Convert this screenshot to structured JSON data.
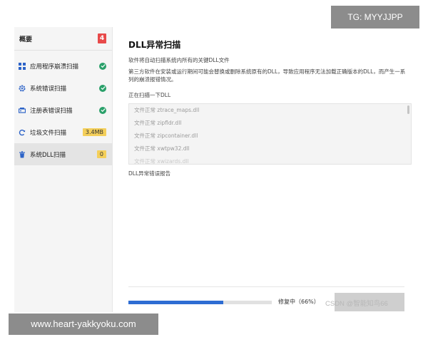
{
  "sidebar": {
    "header": {
      "title": "概要",
      "count": "4"
    },
    "items": [
      {
        "label": "应用程序崩溃扫描",
        "icon": "app-grid-icon",
        "status": "done"
      },
      {
        "label": "系统错误扫描",
        "icon": "gear-icon",
        "status": "done"
      },
      {
        "label": "注册表错误扫描",
        "icon": "registry-icon",
        "status": "done"
      },
      {
        "label": "垃圾文件扫描",
        "icon": "refresh-icon",
        "badge": "3.4MB"
      },
      {
        "label": "系统DLL扫描",
        "icon": "trash-icon",
        "badge": "0"
      }
    ]
  },
  "main": {
    "title": "DLL异常扫描",
    "desc1": "软件将自动扫描系统内所有的关键DLL文件",
    "desc2": "第三方软件在安装或运行期间可能会替换或删除系统原有的DLL，导致应用程序无法加载正确版本的DLL，而产生一系列的崩溃报错情况。",
    "scanning_label": "正在扫描一下DLL",
    "scan_list": [
      "文件正常 ztrace_maps.dll",
      "文件正常 zipfldr.dll",
      "文件正常 zipcontainer.dll",
      "文件正常 xwtpw32.dll",
      "文件正常 xwizards.dll"
    ],
    "report_label": "DLL异常错误报告",
    "progress": {
      "percent": 66,
      "text": "修复中（66%）"
    },
    "action_button": ""
  },
  "watermarks": {
    "top": "TG: MYYJJPP",
    "bottom": "www.heart-yakkyoku.com",
    "csdn": "CSDN @智能知鸟66"
  },
  "colors": {
    "accent": "#2e6dd3",
    "success": "#2aa06a",
    "alert": "#e84a4a",
    "badge": "#f4cf5a"
  }
}
